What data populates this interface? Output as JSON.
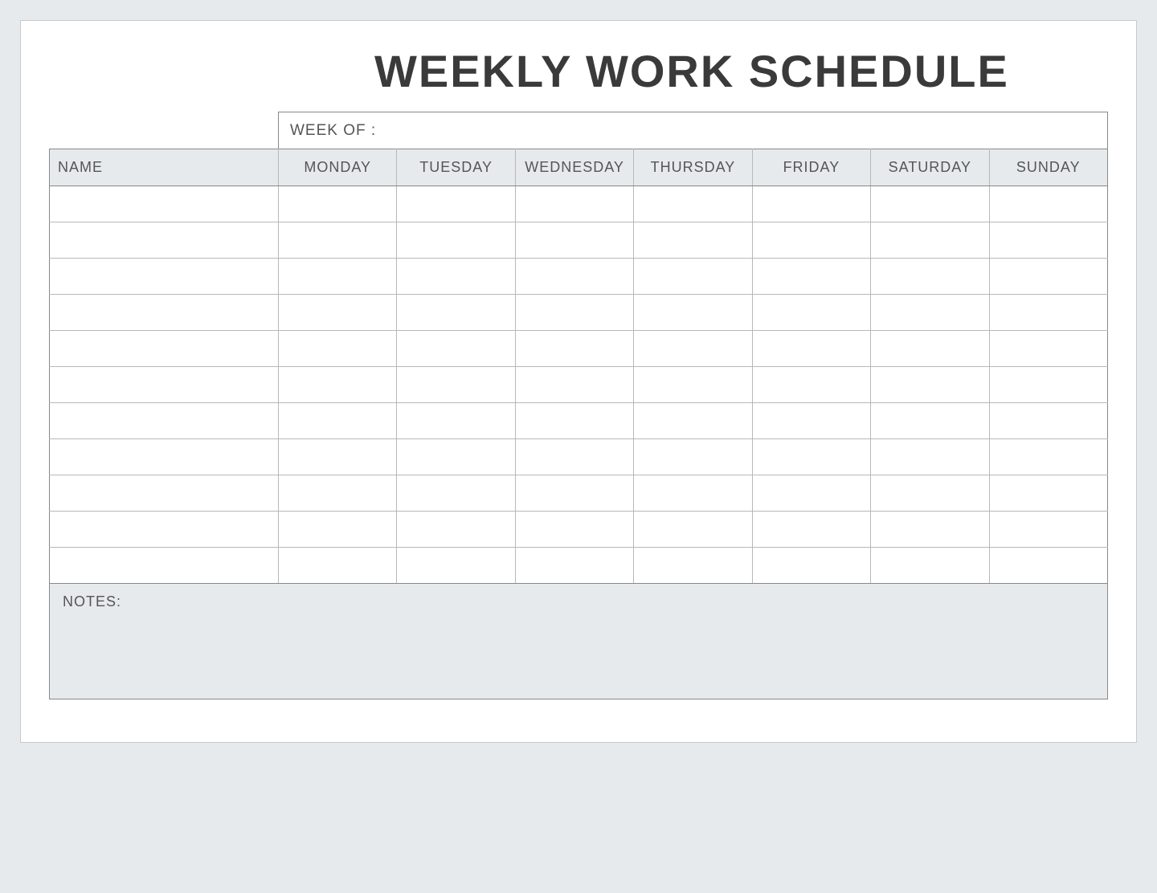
{
  "title": "WEEKLY WORK SCHEDULE",
  "weekOfLabel": "WEEK OF :",
  "weekOfValue": "",
  "headers": {
    "name": "NAME",
    "days": [
      "MONDAY",
      "TUESDAY",
      "WEDNESDAY",
      "THURSDAY",
      "FRIDAY",
      "SATURDAY",
      "SUNDAY"
    ]
  },
  "rows": [
    {
      "name": "",
      "cells": [
        "",
        "",
        "",
        "",
        "",
        "",
        ""
      ]
    },
    {
      "name": "",
      "cells": [
        "",
        "",
        "",
        "",
        "",
        "",
        ""
      ]
    },
    {
      "name": "",
      "cells": [
        "",
        "",
        "",
        "",
        "",
        "",
        ""
      ]
    },
    {
      "name": "",
      "cells": [
        "",
        "",
        "",
        "",
        "",
        "",
        ""
      ]
    },
    {
      "name": "",
      "cells": [
        "",
        "",
        "",
        "",
        "",
        "",
        ""
      ]
    },
    {
      "name": "",
      "cells": [
        "",
        "",
        "",
        "",
        "",
        "",
        ""
      ]
    },
    {
      "name": "",
      "cells": [
        "",
        "",
        "",
        "",
        "",
        "",
        ""
      ]
    },
    {
      "name": "",
      "cells": [
        "",
        "",
        "",
        "",
        "",
        "",
        ""
      ]
    },
    {
      "name": "",
      "cells": [
        "",
        "",
        "",
        "",
        "",
        "",
        ""
      ]
    },
    {
      "name": "",
      "cells": [
        "",
        "",
        "",
        "",
        "",
        "",
        ""
      ]
    },
    {
      "name": "",
      "cells": [
        "",
        "",
        "",
        "",
        "",
        "",
        ""
      ]
    }
  ],
  "notesLabel": "NOTES:",
  "notesValue": ""
}
